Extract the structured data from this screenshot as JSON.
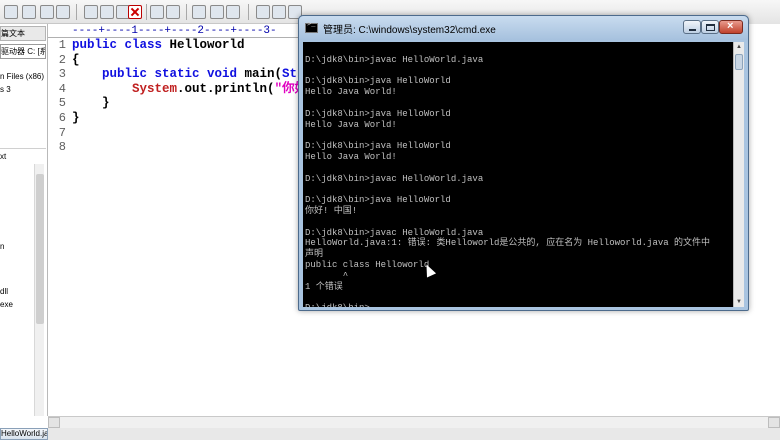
{
  "editor": {
    "ruler": "----+----1----+----2----+----3-",
    "left_panel": {
      "tab_label": "篇文本",
      "combo_value": "驱动器 C: [系统动力节点]",
      "items": [
        "n Files (x86)",
        "s 3",
        "xt",
        "n",
        "dll",
        "exe"
      ]
    },
    "line_numbers": [
      "1",
      "2",
      "3",
      "4",
      "5",
      "6",
      "7",
      "8"
    ],
    "code": {
      "line1_kw": "public class ",
      "line1_id": "Helloworld",
      "line2": "{",
      "line3_kw": "    public static void ",
      "line3_id": "main(",
      "line3_tail": "Str",
      "line4_indent": "        ",
      "line4_red": "System",
      "line4_mid": ".out.println(",
      "line4_str": "\"你好",
      "line5": "    }",
      "line6": "}"
    },
    "file_tab": "HelloWorld.java",
    "colors": {
      "keyword": "#1010e0",
      "string": "#e000c0",
      "class_ref": "#c02020"
    }
  },
  "cmd": {
    "title": "管理员: C:\\windows\\system32\\cmd.exe",
    "icon": "cmd-icon",
    "buttons": {
      "minimize": "minimize-icon",
      "maximize": "maximize-icon",
      "close": "close-icon"
    },
    "output": "\nD:\\jdk8\\bin>javac HelloWorld.java\n\nD:\\jdk8\\bin>java HelloWorld\nHello Java World!\n\nD:\\jdk8\\bin>java HelloWorld\nHello Java World!\n\nD:\\jdk8\\bin>java HelloWorld\nHello Java World!\n\nD:\\jdk8\\bin>javac HelloWorld.java\n\nD:\\jdk8\\bin>java HelloWorld\n你好! 中国!\n\nD:\\jdk8\\bin>javac HelloWorld.java\nHelloWorld.java:1: 错误: 类Helloworld是公共的, 应在名为 Helloworld.java 的文件中\n声明\npublic class Helloworld\n       ^\n1 个错误\n\nD:\\jdk8\\bin>",
    "colors": {
      "background": "#000000",
      "text": "#c0c0c0"
    }
  }
}
